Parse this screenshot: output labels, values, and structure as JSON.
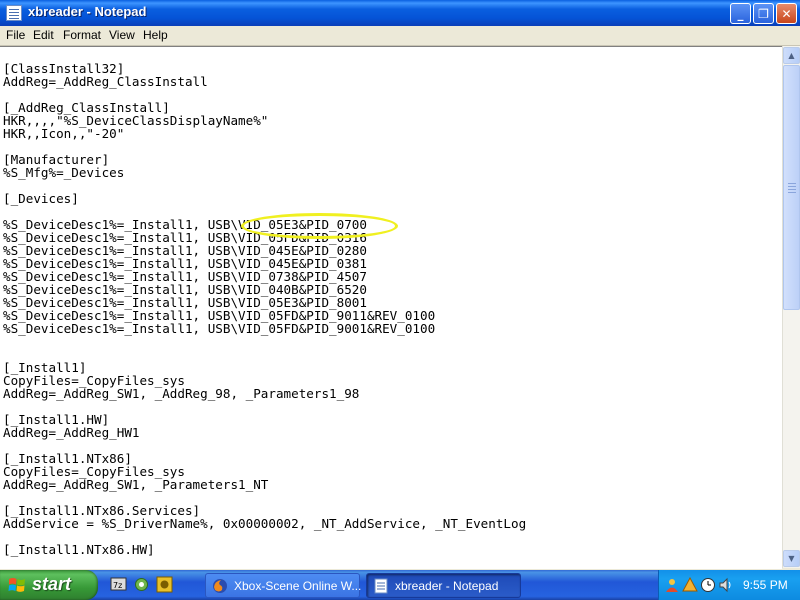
{
  "window": {
    "title": "xbreader - Notepad",
    "buttons": {
      "minimize": "_",
      "maximize": "❐",
      "close": "✕"
    }
  },
  "menu": [
    "File",
    "Edit",
    "Format",
    "View",
    "Help"
  ],
  "editor": {
    "lines": [
      "",
      "[ClassInstall32]",
      "AddReg=_AddReg_ClassInstall",
      "",
      "[_AddReg_ClassInstall]",
      "HKR,,,,\"%S_DeviceClassDisplayName%\"",
      "HKR,,Icon,,\"-20\"",
      "",
      "[Manufacturer]",
      "%S_Mfg%=_Devices",
      "",
      "[_Devices]",
      "",
      "%S_DeviceDesc1%=_Install1, USB\\VID_05E3&PID_0700",
      "%S_DeviceDesc1%=_Install1, USB\\VID_05FD&PID_0316",
      "%S_DeviceDesc1%=_Install1, USB\\VID_045E&PID_0280",
      "%S_DeviceDesc1%=_Install1, USB\\VID_045E&PID_0381",
      "%S_DeviceDesc1%=_Install1, USB\\VID_0738&PID_4507",
      "%S_DeviceDesc1%=_Install1, USB\\VID_040B&PID_6520",
      "%S_DeviceDesc1%=_Install1, USB\\VID_05E3&PID_8001",
      "%S_DeviceDesc1%=_Install1, USB\\VID_05FD&PID_9011&REV_0100",
      "%S_DeviceDesc1%=_Install1, USB\\VID_05FD&PID_9001&REV_0100",
      "",
      "",
      "[_Install1]",
      "CopyFiles=_CopyFiles_sys",
      "AddReg=_AddReg_SW1, _AddReg_98, _Parameters1_98",
      "",
      "[_Install1.HW]",
      "AddReg=_AddReg_HW1",
      "",
      "[_Install1.NTx86]",
      "CopyFiles=_CopyFiles_sys",
      "AddReg=_AddReg_SW1, _Parameters1_NT",
      "",
      "[_Install1.NTx86.Services]",
      "AddService = %S_DriverName%, 0x00000002, _NT_AddService, _NT_EventLog",
      "",
      "[_Install1.NTx86.HW]"
    ],
    "highlight_color": "#F0F020"
  },
  "scrollbar": {
    "up": "▲",
    "down": "▼"
  },
  "taskbar": {
    "start_label": "start",
    "quick_launch": [
      "windows-explorer-icon",
      "settings-icon",
      "media-icon"
    ],
    "tasks": [
      {
        "label": "Xbox-Scene Online W...",
        "icon": "firefox-icon",
        "active": false
      },
      {
        "label": "xbreader - Notepad",
        "icon": "notepad-icon",
        "active": true
      }
    ],
    "tray_icons": [
      "user-icon",
      "network-icon",
      "clock-icon",
      "sound-icon"
    ],
    "clock": "9:55 PM"
  }
}
